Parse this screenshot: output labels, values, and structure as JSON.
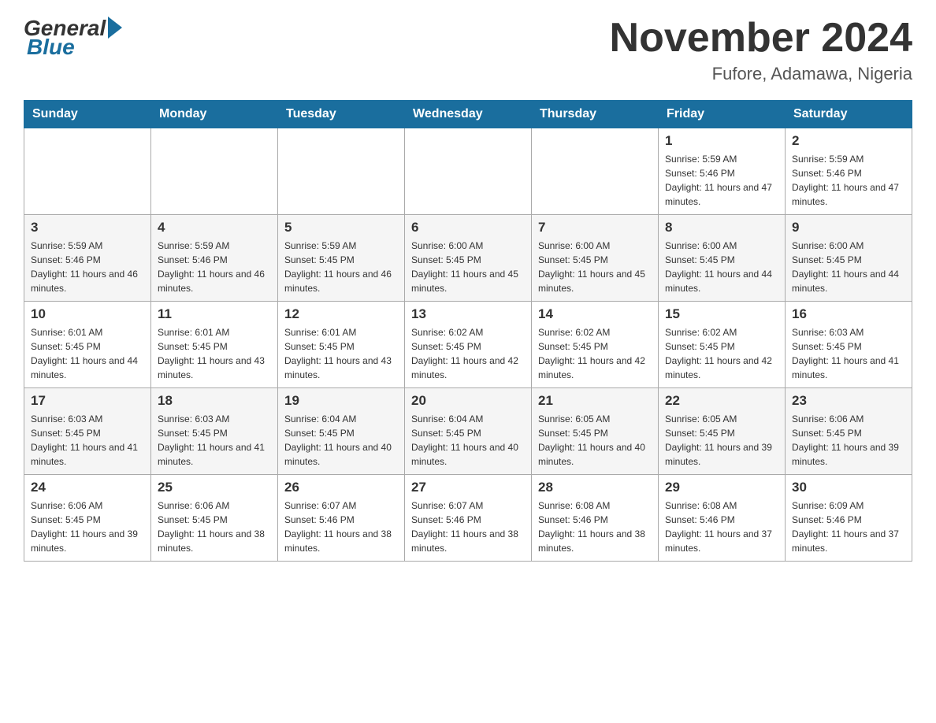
{
  "header": {
    "logo": {
      "general": "General",
      "blue": "Blue"
    },
    "title": "November 2024",
    "location": "Fufore, Adamawa, Nigeria"
  },
  "calendar": {
    "days_of_week": [
      "Sunday",
      "Monday",
      "Tuesday",
      "Wednesday",
      "Thursday",
      "Friday",
      "Saturday"
    ],
    "weeks": [
      [
        {
          "day": "",
          "info": ""
        },
        {
          "day": "",
          "info": ""
        },
        {
          "day": "",
          "info": ""
        },
        {
          "day": "",
          "info": ""
        },
        {
          "day": "",
          "info": ""
        },
        {
          "day": "1",
          "info": "Sunrise: 5:59 AM\nSunset: 5:46 PM\nDaylight: 11 hours and 47 minutes."
        },
        {
          "day": "2",
          "info": "Sunrise: 5:59 AM\nSunset: 5:46 PM\nDaylight: 11 hours and 47 minutes."
        }
      ],
      [
        {
          "day": "3",
          "info": "Sunrise: 5:59 AM\nSunset: 5:46 PM\nDaylight: 11 hours and 46 minutes."
        },
        {
          "day": "4",
          "info": "Sunrise: 5:59 AM\nSunset: 5:46 PM\nDaylight: 11 hours and 46 minutes."
        },
        {
          "day": "5",
          "info": "Sunrise: 5:59 AM\nSunset: 5:45 PM\nDaylight: 11 hours and 46 minutes."
        },
        {
          "day": "6",
          "info": "Sunrise: 6:00 AM\nSunset: 5:45 PM\nDaylight: 11 hours and 45 minutes."
        },
        {
          "day": "7",
          "info": "Sunrise: 6:00 AM\nSunset: 5:45 PM\nDaylight: 11 hours and 45 minutes."
        },
        {
          "day": "8",
          "info": "Sunrise: 6:00 AM\nSunset: 5:45 PM\nDaylight: 11 hours and 44 minutes."
        },
        {
          "day": "9",
          "info": "Sunrise: 6:00 AM\nSunset: 5:45 PM\nDaylight: 11 hours and 44 minutes."
        }
      ],
      [
        {
          "day": "10",
          "info": "Sunrise: 6:01 AM\nSunset: 5:45 PM\nDaylight: 11 hours and 44 minutes."
        },
        {
          "day": "11",
          "info": "Sunrise: 6:01 AM\nSunset: 5:45 PM\nDaylight: 11 hours and 43 minutes."
        },
        {
          "day": "12",
          "info": "Sunrise: 6:01 AM\nSunset: 5:45 PM\nDaylight: 11 hours and 43 minutes."
        },
        {
          "day": "13",
          "info": "Sunrise: 6:02 AM\nSunset: 5:45 PM\nDaylight: 11 hours and 42 minutes."
        },
        {
          "day": "14",
          "info": "Sunrise: 6:02 AM\nSunset: 5:45 PM\nDaylight: 11 hours and 42 minutes."
        },
        {
          "day": "15",
          "info": "Sunrise: 6:02 AM\nSunset: 5:45 PM\nDaylight: 11 hours and 42 minutes."
        },
        {
          "day": "16",
          "info": "Sunrise: 6:03 AM\nSunset: 5:45 PM\nDaylight: 11 hours and 41 minutes."
        }
      ],
      [
        {
          "day": "17",
          "info": "Sunrise: 6:03 AM\nSunset: 5:45 PM\nDaylight: 11 hours and 41 minutes."
        },
        {
          "day": "18",
          "info": "Sunrise: 6:03 AM\nSunset: 5:45 PM\nDaylight: 11 hours and 41 minutes."
        },
        {
          "day": "19",
          "info": "Sunrise: 6:04 AM\nSunset: 5:45 PM\nDaylight: 11 hours and 40 minutes."
        },
        {
          "day": "20",
          "info": "Sunrise: 6:04 AM\nSunset: 5:45 PM\nDaylight: 11 hours and 40 minutes."
        },
        {
          "day": "21",
          "info": "Sunrise: 6:05 AM\nSunset: 5:45 PM\nDaylight: 11 hours and 40 minutes."
        },
        {
          "day": "22",
          "info": "Sunrise: 6:05 AM\nSunset: 5:45 PM\nDaylight: 11 hours and 39 minutes."
        },
        {
          "day": "23",
          "info": "Sunrise: 6:06 AM\nSunset: 5:45 PM\nDaylight: 11 hours and 39 minutes."
        }
      ],
      [
        {
          "day": "24",
          "info": "Sunrise: 6:06 AM\nSunset: 5:45 PM\nDaylight: 11 hours and 39 minutes."
        },
        {
          "day": "25",
          "info": "Sunrise: 6:06 AM\nSunset: 5:45 PM\nDaylight: 11 hours and 38 minutes."
        },
        {
          "day": "26",
          "info": "Sunrise: 6:07 AM\nSunset: 5:46 PM\nDaylight: 11 hours and 38 minutes."
        },
        {
          "day": "27",
          "info": "Sunrise: 6:07 AM\nSunset: 5:46 PM\nDaylight: 11 hours and 38 minutes."
        },
        {
          "day": "28",
          "info": "Sunrise: 6:08 AM\nSunset: 5:46 PM\nDaylight: 11 hours and 38 minutes."
        },
        {
          "day": "29",
          "info": "Sunrise: 6:08 AM\nSunset: 5:46 PM\nDaylight: 11 hours and 37 minutes."
        },
        {
          "day": "30",
          "info": "Sunrise: 6:09 AM\nSunset: 5:46 PM\nDaylight: 11 hours and 37 minutes."
        }
      ]
    ]
  }
}
